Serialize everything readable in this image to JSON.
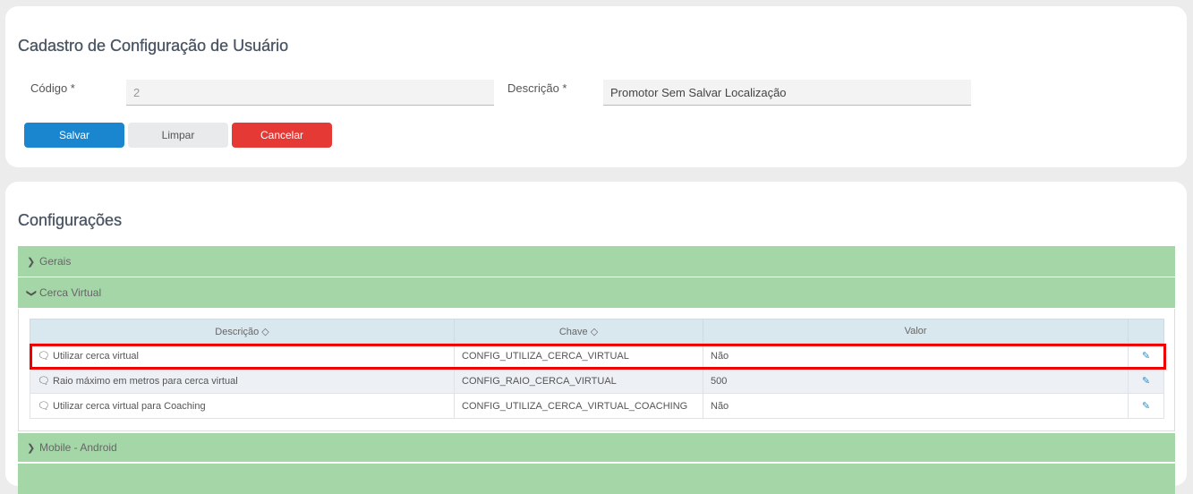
{
  "form": {
    "title": "Cadastro de Configuração de Usuário",
    "codigo_label": "Código *",
    "codigo_value": "2",
    "descricao_label": "Descrição *",
    "descricao_value": "Promotor Sem Salvar Localização",
    "save": "Salvar",
    "clear": "Limpar",
    "cancel": "Cancelar"
  },
  "config": {
    "title": "Configurações",
    "sections": [
      {
        "label": "Gerais"
      },
      {
        "label": "Cerca Virtual"
      },
      {
        "label": "Mobile - Android"
      }
    ],
    "columns": [
      "Descrição ◇",
      "Chave ◇",
      "Valor",
      ""
    ],
    "rows": [
      {
        "desc": "Utilizar cerca virtual",
        "key": "CONFIG_UTILIZA_CERCA_VIRTUAL",
        "value": "Não"
      },
      {
        "desc": "Raio máximo em metros para cerca virtual",
        "key": "CONFIG_RAIO_CERCA_VIRTUAL",
        "value": "500"
      },
      {
        "desc": "Utilizar cerca virtual para Coaching",
        "key": "CONFIG_UTILIZA_CERCA_VIRTUAL_COACHING",
        "value": "Não"
      }
    ]
  }
}
